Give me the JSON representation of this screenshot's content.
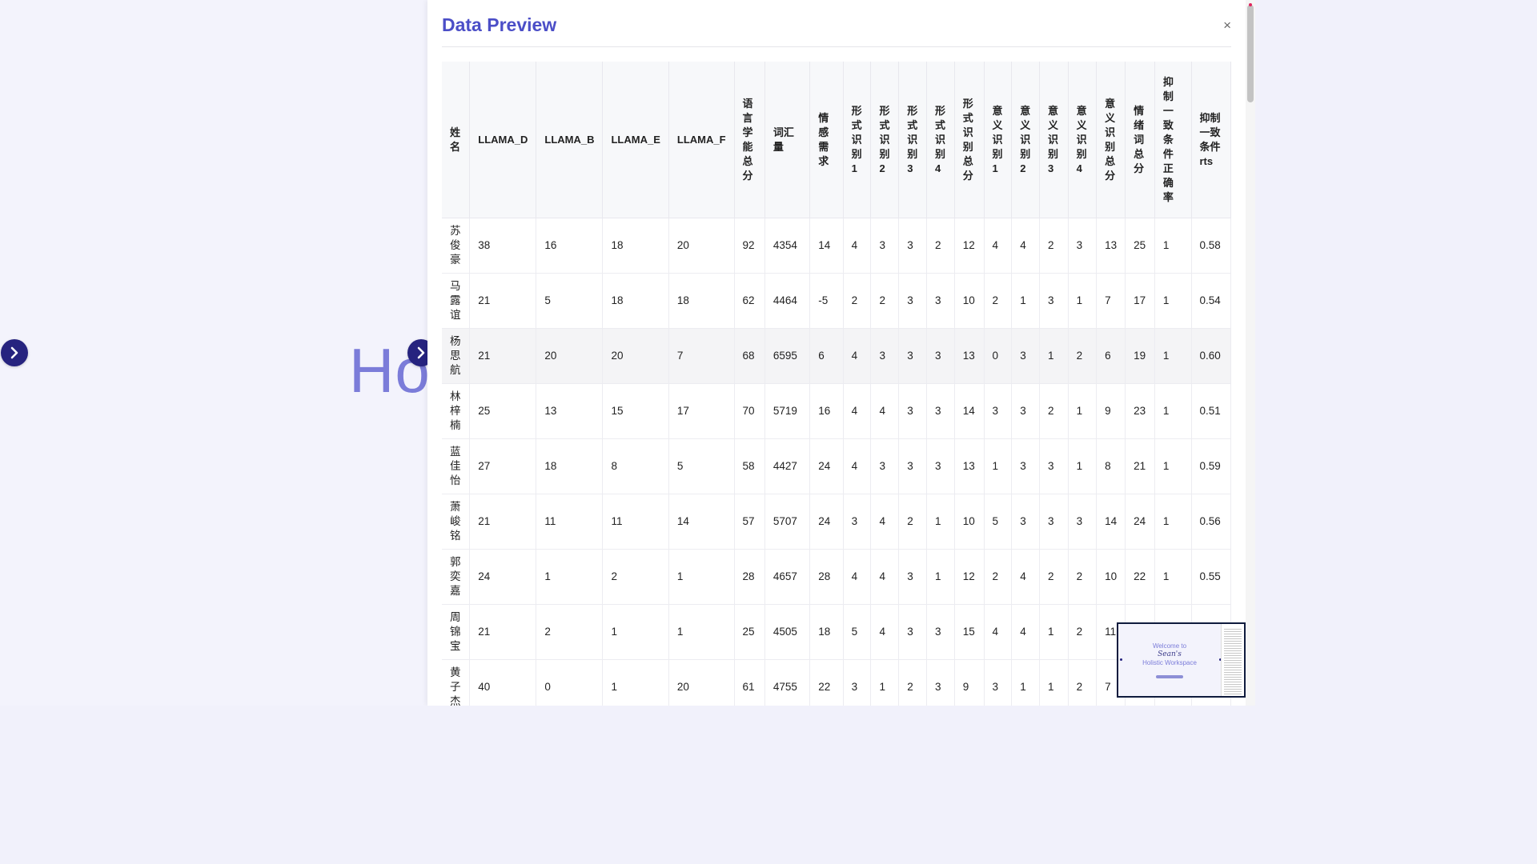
{
  "background": {
    "hero_text": "Ho"
  },
  "panel": {
    "title": "Data Preview",
    "close_label": "×"
  },
  "table": {
    "columns": [
      "姓名",
      "LLAMA_D",
      "LLAMA_B",
      "LLAMA_E",
      "LLAMA_F",
      "语言学能总分",
      "词汇量",
      "情感需求",
      "形式识别1",
      "形式识别2",
      "形式识别3",
      "形式识别4",
      "形式识别总分",
      "意义识别1",
      "意义识别2",
      "意义识别3",
      "意义识别4",
      "意义识别总分",
      "情绪词总分",
      "抑制一致条件正确率",
      "抑制一致条件rts"
    ],
    "rows": [
      [
        "苏俊豪",
        "38",
        "16",
        "18",
        "20",
        "92",
        "4354",
        "14",
        "4",
        "3",
        "3",
        "2",
        "12",
        "4",
        "4",
        "2",
        "3",
        "13",
        "25",
        "1",
        "0.58"
      ],
      [
        "马露谊",
        "21",
        "5",
        "18",
        "18",
        "62",
        "4464",
        "-5",
        "2",
        "2",
        "3",
        "3",
        "10",
        "2",
        "1",
        "3",
        "1",
        "7",
        "17",
        "1",
        "0.54"
      ],
      [
        "杨思航",
        "21",
        "20",
        "20",
        "7",
        "68",
        "6595",
        "6",
        "4",
        "3",
        "3",
        "3",
        "13",
        "0",
        "3",
        "1",
        "2",
        "6",
        "19",
        "1",
        "0.60"
      ],
      [
        "林梓楠",
        "25",
        "13",
        "15",
        "17",
        "70",
        "5719",
        "16",
        "4",
        "4",
        "3",
        "3",
        "14",
        "3",
        "3",
        "2",
        "1",
        "9",
        "23",
        "1",
        "0.51"
      ],
      [
        "蓝佳怡",
        "27",
        "18",
        "8",
        "5",
        "58",
        "4427",
        "24",
        "4",
        "3",
        "3",
        "3",
        "13",
        "1",
        "3",
        "3",
        "1",
        "8",
        "21",
        "1",
        "0.59"
      ],
      [
        "萧峻铭",
        "21",
        "11",
        "11",
        "14",
        "57",
        "5707",
        "24",
        "3",
        "4",
        "2",
        "1",
        "10",
        "5",
        "3",
        "3",
        "3",
        "14",
        "24",
        "1",
        "0.56"
      ],
      [
        "郭奕嘉",
        "24",
        "1",
        "2",
        "1",
        "28",
        "4657",
        "28",
        "4",
        "4",
        "3",
        "1",
        "12",
        "2",
        "4",
        "2",
        "2",
        "10",
        "22",
        "1",
        "0.55"
      ],
      [
        "周锦宝",
        "21",
        "2",
        "1",
        "1",
        "25",
        "4505",
        "18",
        "5",
        "4",
        "3",
        "3",
        "15",
        "4",
        "4",
        "1",
        "2",
        "11",
        "",
        "",
        ""
      ],
      [
        "黄子杰",
        "40",
        "0",
        "1",
        "20",
        "61",
        "4755",
        "22",
        "3",
        "1",
        "2",
        "3",
        "9",
        "3",
        "1",
        "1",
        "2",
        "7",
        "",
        "",
        ""
      ]
    ]
  },
  "minimap": {
    "line1": "Welcome to",
    "line2": "Sean's",
    "line3": "Holistic Workspace"
  },
  "icons": {
    "nav_left": "chevron-right-icon",
    "nav_mid": "chevron-right-icon",
    "close": "close-icon"
  },
  "colors": {
    "accent": "#4b4ec7",
    "nav_circle": "#26237f",
    "hero_text": "#7b7cd9"
  }
}
